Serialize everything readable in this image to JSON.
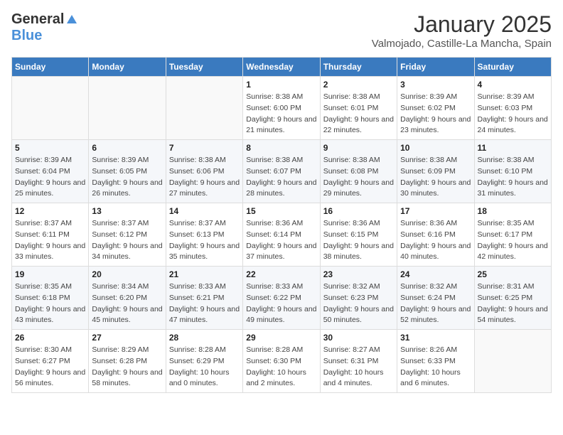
{
  "logo": {
    "general": "General",
    "blue": "Blue"
  },
  "title": "January 2025",
  "subtitle": "Valmojado, Castille-La Mancha, Spain",
  "weekdays": [
    "Sunday",
    "Monday",
    "Tuesday",
    "Wednesday",
    "Thursday",
    "Friday",
    "Saturday"
  ],
  "weeks": [
    [
      {
        "day": "",
        "sunrise": "",
        "sunset": "",
        "daylight": ""
      },
      {
        "day": "",
        "sunrise": "",
        "sunset": "",
        "daylight": ""
      },
      {
        "day": "",
        "sunrise": "",
        "sunset": "",
        "daylight": ""
      },
      {
        "day": "1",
        "sunrise": "Sunrise: 8:38 AM",
        "sunset": "Sunset: 6:00 PM",
        "daylight": "Daylight: 9 hours and 21 minutes."
      },
      {
        "day": "2",
        "sunrise": "Sunrise: 8:38 AM",
        "sunset": "Sunset: 6:01 PM",
        "daylight": "Daylight: 9 hours and 22 minutes."
      },
      {
        "day": "3",
        "sunrise": "Sunrise: 8:39 AM",
        "sunset": "Sunset: 6:02 PM",
        "daylight": "Daylight: 9 hours and 23 minutes."
      },
      {
        "day": "4",
        "sunrise": "Sunrise: 8:39 AM",
        "sunset": "Sunset: 6:03 PM",
        "daylight": "Daylight: 9 hours and 24 minutes."
      }
    ],
    [
      {
        "day": "5",
        "sunrise": "Sunrise: 8:39 AM",
        "sunset": "Sunset: 6:04 PM",
        "daylight": "Daylight: 9 hours and 25 minutes."
      },
      {
        "day": "6",
        "sunrise": "Sunrise: 8:39 AM",
        "sunset": "Sunset: 6:05 PM",
        "daylight": "Daylight: 9 hours and 26 minutes."
      },
      {
        "day": "7",
        "sunrise": "Sunrise: 8:38 AM",
        "sunset": "Sunset: 6:06 PM",
        "daylight": "Daylight: 9 hours and 27 minutes."
      },
      {
        "day": "8",
        "sunrise": "Sunrise: 8:38 AM",
        "sunset": "Sunset: 6:07 PM",
        "daylight": "Daylight: 9 hours and 28 minutes."
      },
      {
        "day": "9",
        "sunrise": "Sunrise: 8:38 AM",
        "sunset": "Sunset: 6:08 PM",
        "daylight": "Daylight: 9 hours and 29 minutes."
      },
      {
        "day": "10",
        "sunrise": "Sunrise: 8:38 AM",
        "sunset": "Sunset: 6:09 PM",
        "daylight": "Daylight: 9 hours and 30 minutes."
      },
      {
        "day": "11",
        "sunrise": "Sunrise: 8:38 AM",
        "sunset": "Sunset: 6:10 PM",
        "daylight": "Daylight: 9 hours and 31 minutes."
      }
    ],
    [
      {
        "day": "12",
        "sunrise": "Sunrise: 8:37 AM",
        "sunset": "Sunset: 6:11 PM",
        "daylight": "Daylight: 9 hours and 33 minutes."
      },
      {
        "day": "13",
        "sunrise": "Sunrise: 8:37 AM",
        "sunset": "Sunset: 6:12 PM",
        "daylight": "Daylight: 9 hours and 34 minutes."
      },
      {
        "day": "14",
        "sunrise": "Sunrise: 8:37 AM",
        "sunset": "Sunset: 6:13 PM",
        "daylight": "Daylight: 9 hours and 35 minutes."
      },
      {
        "day": "15",
        "sunrise": "Sunrise: 8:36 AM",
        "sunset": "Sunset: 6:14 PM",
        "daylight": "Daylight: 9 hours and 37 minutes."
      },
      {
        "day": "16",
        "sunrise": "Sunrise: 8:36 AM",
        "sunset": "Sunset: 6:15 PM",
        "daylight": "Daylight: 9 hours and 38 minutes."
      },
      {
        "day": "17",
        "sunrise": "Sunrise: 8:36 AM",
        "sunset": "Sunset: 6:16 PM",
        "daylight": "Daylight: 9 hours and 40 minutes."
      },
      {
        "day": "18",
        "sunrise": "Sunrise: 8:35 AM",
        "sunset": "Sunset: 6:17 PM",
        "daylight": "Daylight: 9 hours and 42 minutes."
      }
    ],
    [
      {
        "day": "19",
        "sunrise": "Sunrise: 8:35 AM",
        "sunset": "Sunset: 6:18 PM",
        "daylight": "Daylight: 9 hours and 43 minutes."
      },
      {
        "day": "20",
        "sunrise": "Sunrise: 8:34 AM",
        "sunset": "Sunset: 6:20 PM",
        "daylight": "Daylight: 9 hours and 45 minutes."
      },
      {
        "day": "21",
        "sunrise": "Sunrise: 8:33 AM",
        "sunset": "Sunset: 6:21 PM",
        "daylight": "Daylight: 9 hours and 47 minutes."
      },
      {
        "day": "22",
        "sunrise": "Sunrise: 8:33 AM",
        "sunset": "Sunset: 6:22 PM",
        "daylight": "Daylight: 9 hours and 49 minutes."
      },
      {
        "day": "23",
        "sunrise": "Sunrise: 8:32 AM",
        "sunset": "Sunset: 6:23 PM",
        "daylight": "Daylight: 9 hours and 50 minutes."
      },
      {
        "day": "24",
        "sunrise": "Sunrise: 8:32 AM",
        "sunset": "Sunset: 6:24 PM",
        "daylight": "Daylight: 9 hours and 52 minutes."
      },
      {
        "day": "25",
        "sunrise": "Sunrise: 8:31 AM",
        "sunset": "Sunset: 6:25 PM",
        "daylight": "Daylight: 9 hours and 54 minutes."
      }
    ],
    [
      {
        "day": "26",
        "sunrise": "Sunrise: 8:30 AM",
        "sunset": "Sunset: 6:27 PM",
        "daylight": "Daylight: 9 hours and 56 minutes."
      },
      {
        "day": "27",
        "sunrise": "Sunrise: 8:29 AM",
        "sunset": "Sunset: 6:28 PM",
        "daylight": "Daylight: 9 hours and 58 minutes."
      },
      {
        "day": "28",
        "sunrise": "Sunrise: 8:28 AM",
        "sunset": "Sunset: 6:29 PM",
        "daylight": "Daylight: 10 hours and 0 minutes."
      },
      {
        "day": "29",
        "sunrise": "Sunrise: 8:28 AM",
        "sunset": "Sunset: 6:30 PM",
        "daylight": "Daylight: 10 hours and 2 minutes."
      },
      {
        "day": "30",
        "sunrise": "Sunrise: 8:27 AM",
        "sunset": "Sunset: 6:31 PM",
        "daylight": "Daylight: 10 hours and 4 minutes."
      },
      {
        "day": "31",
        "sunrise": "Sunrise: 8:26 AM",
        "sunset": "Sunset: 6:33 PM",
        "daylight": "Daylight: 10 hours and 6 minutes."
      },
      {
        "day": "",
        "sunrise": "",
        "sunset": "",
        "daylight": ""
      }
    ]
  ]
}
